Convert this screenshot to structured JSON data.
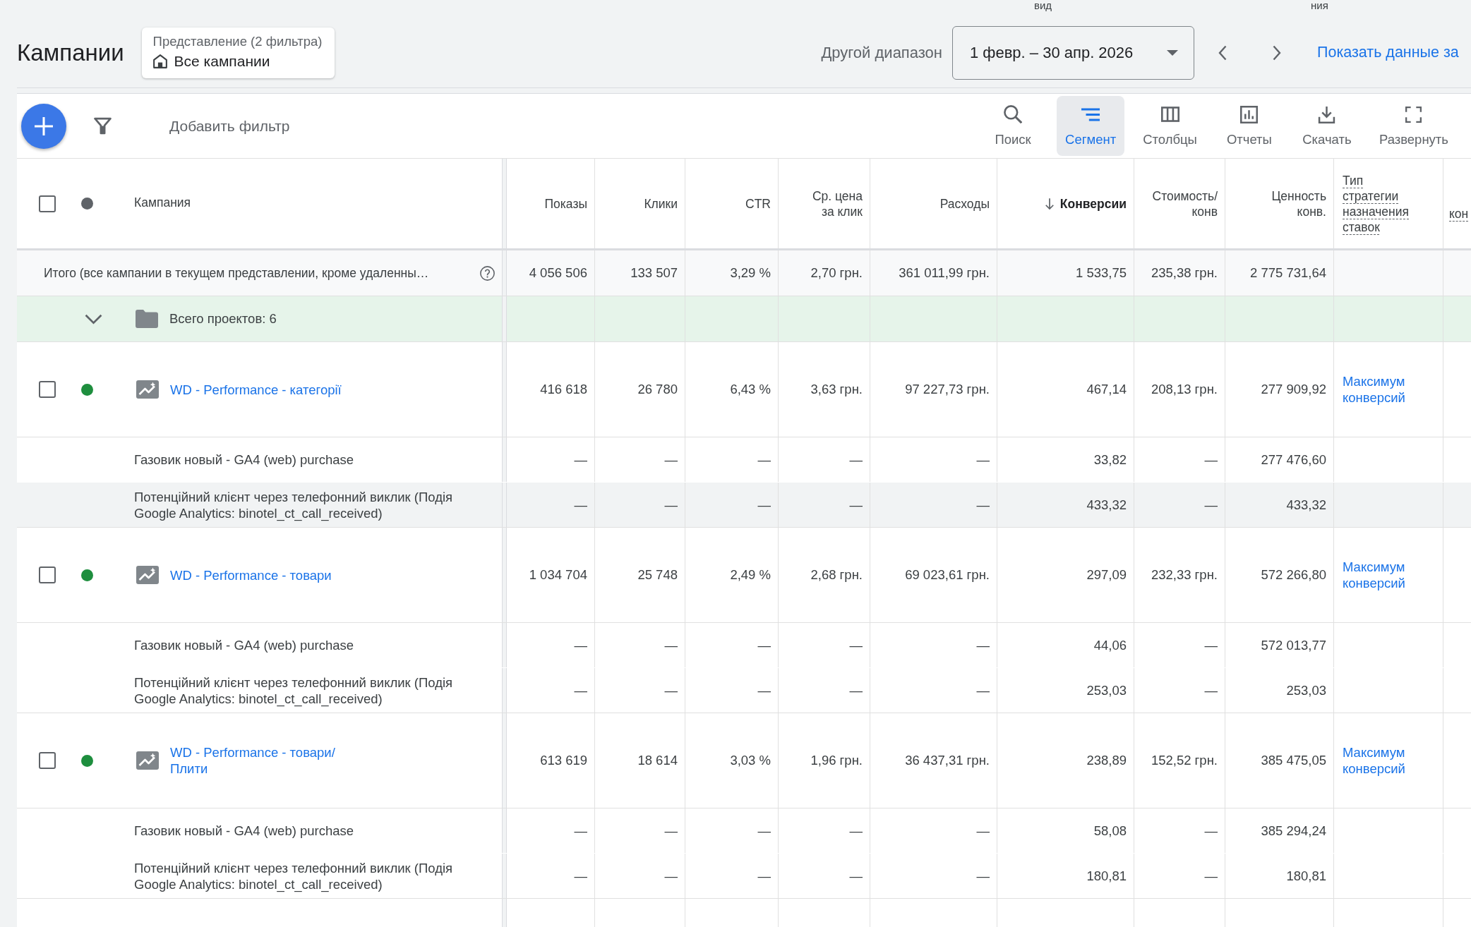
{
  "top_labels": [
    "вид",
    "ния"
  ],
  "header": {
    "title": "Кампании",
    "view": {
      "caption": "Представление (2 фильтра)",
      "name": "Все кампании"
    },
    "date_range": {
      "label": "Другой диапазон",
      "value": "1 февр. – 30 апр. 2026"
    },
    "compare_link": "Показать данные за"
  },
  "toolbar": {
    "add_filter": "Добавить фильтр",
    "tools": [
      {
        "label": "Поиск",
        "kind": "search",
        "selected": false
      },
      {
        "label": "Сегмент",
        "kind": "segment",
        "selected": true
      },
      {
        "label": "Столбцы",
        "kind": "columns",
        "selected": false
      },
      {
        "label": "Отчеты",
        "kind": "reports",
        "selected": false
      },
      {
        "label": "Скачать",
        "kind": "download",
        "selected": false
      },
      {
        "label": "Развернуть",
        "kind": "expand",
        "selected": false
      }
    ]
  },
  "table": {
    "select_all_checked": false,
    "columns": [
      {
        "label": "Кампания",
        "sorted": false,
        "underlined": false
      },
      {
        "label": "Показы",
        "sorted": false,
        "underlined": false
      },
      {
        "label": "Клики",
        "sorted": false,
        "underlined": false
      },
      {
        "label": "CTR",
        "sorted": false,
        "underlined": false
      },
      {
        "label": "Ср. цена за клик",
        "sorted": false,
        "underlined": false
      },
      {
        "label": "Расходы",
        "sorted": false,
        "underlined": false
      },
      {
        "label": "Конверсии",
        "sorted": true,
        "underlined": false
      },
      {
        "label": "Стоимость/ конв",
        "sorted": false,
        "underlined": false
      },
      {
        "label": "Ценность конв.",
        "sorted": false,
        "underlined": false
      },
      {
        "label": "Тип стратегии назначения ставок",
        "sorted": false,
        "underlined": true
      },
      {
        "label": "кон",
        "sorted": false,
        "underlined": true
      }
    ],
    "totals": {
      "label": "Итого (все кампании в текущем представлении, кроме удаленны…",
      "values": [
        "4 056 506",
        "133 507",
        "3,29 %",
        "2,70 грн.",
        "361 011,99 грн.",
        "1 533,75",
        "235,38 грн.",
        "2 775 731,64"
      ]
    },
    "group": {
      "label": "Всего проектов: 6",
      "expanded": true
    },
    "campaigns": [
      {
        "checked": false,
        "color": "#1e8e3e",
        "name": "WD - Performance - категорії",
        "values": [
          "416 618",
          "26 780",
          "6,43 %",
          "3,63 грн.",
          "97 227,73 грн.",
          "467,14",
          "208,13 грн.",
          "277 909,92"
        ],
        "bid_strategy": "Максимум конверсий",
        "conversions": [
          {
            "name": "Газовик новый - GA4 (web) purchase",
            "highlighted": false,
            "values": [
              "—",
              "—",
              "—",
              "—",
              "—",
              "33,82",
              "—",
              "277 476,60"
            ]
          },
          {
            "name": "Потенційний клієнт через телефонний виклик (Подія Google Analytics: binotel_ct_call_received)",
            "highlighted": true,
            "values": [
              "—",
              "—",
              "—",
              "—",
              "—",
              "433,32",
              "—",
              "433,32"
            ]
          }
        ]
      },
      {
        "checked": false,
        "color": "#1e8e3e",
        "name": "WD - Performance - товари",
        "values": [
          "1 034 704",
          "25 748",
          "2,49 %",
          "2,68 грн.",
          "69 023,61 грн.",
          "297,09",
          "232,33 грн.",
          "572 266,80"
        ],
        "bid_strategy": "Максимум конверсий",
        "conversions": [
          {
            "name": "Газовик новый - GA4 (web) purchase",
            "highlighted": false,
            "values": [
              "—",
              "—",
              "—",
              "—",
              "—",
              "44,06",
              "—",
              "572 013,77"
            ]
          },
          {
            "name": "Потенційний клієнт через телефонний виклик (Подія Google Analytics: binotel_ct_call_received)",
            "highlighted": false,
            "values": [
              "—",
              "—",
              "—",
              "—",
              "—",
              "253,03",
              "—",
              "253,03"
            ]
          }
        ]
      },
      {
        "checked": false,
        "color": "#1e8e3e",
        "name": "WD - Performance - товари/ Плити",
        "values": [
          "613 619",
          "18 614",
          "3,03 %",
          "1,96 грн.",
          "36 437,31 грн.",
          "238,89",
          "152,52 грн.",
          "385 475,05"
        ],
        "bid_strategy": "Максимум конверсий",
        "conversions": [
          {
            "name": "Газовик новый - GA4 (web) purchase",
            "highlighted": false,
            "values": [
              "—",
              "—",
              "—",
              "—",
              "—",
              "58,08",
              "—",
              "385 294,24"
            ]
          },
          {
            "name": "Потенційний клієнт через телефонний виклик (Подія Google Analytics: binotel_ct_call_received)",
            "highlighted": false,
            "values": [
              "—",
              "—",
              "—",
              "—",
              "—",
              "180,81",
              "—",
              "180,81"
            ]
          }
        ]
      }
    ]
  }
}
